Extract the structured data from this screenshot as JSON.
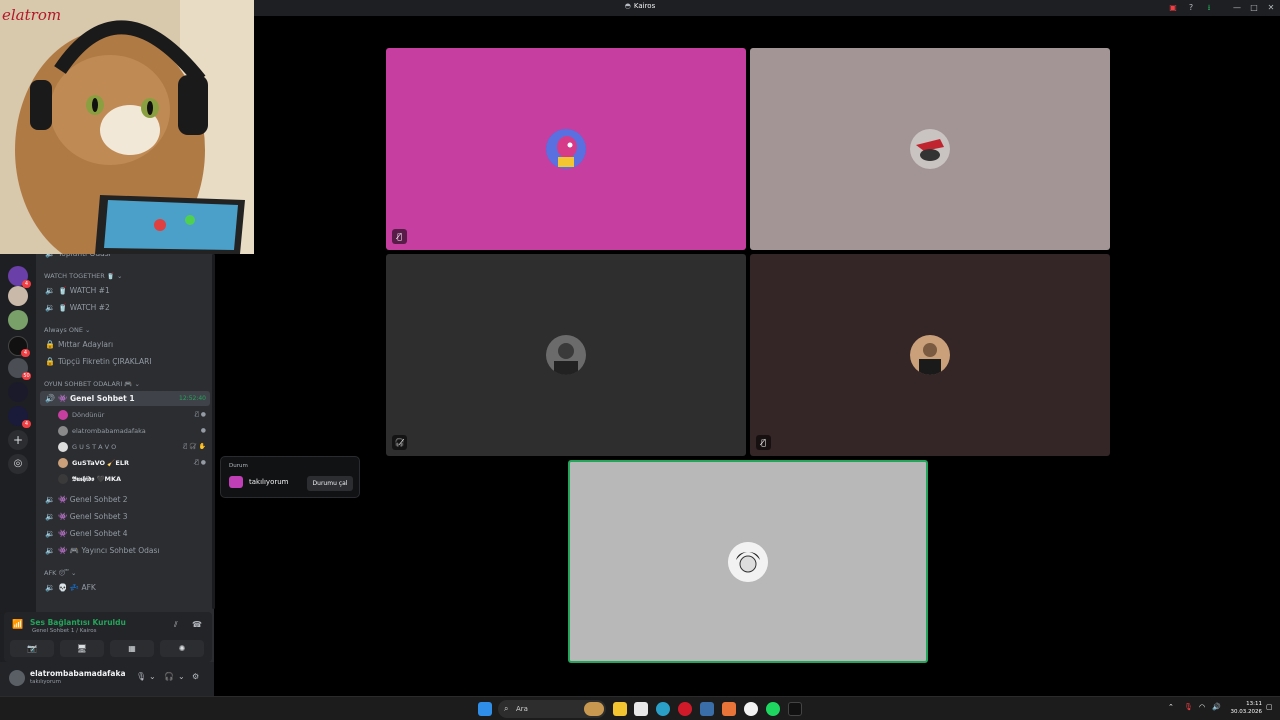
{
  "window": {
    "title": "Kairos"
  },
  "pip": {
    "label": "elatrom"
  },
  "channels": {
    "top_partial": "Toplantı Odası",
    "categories": [
      {
        "label": "WATCH TOGETHER 🥤 ⌄"
      },
      {
        "label": "Always ONE ⌄"
      },
      {
        "label": "OYUN SOHBET ODALARI 🎮 ⌄"
      },
      {
        "label": "AFK 😴 ⌄"
      }
    ],
    "items": [
      {
        "label": "🥤 WATCH #1"
      },
      {
        "label": "🥤 WATCH #2"
      },
      {
        "label": "Mıttar Adayları"
      },
      {
        "label": "Tüpçü Fikretin ÇIRAKLARI"
      },
      {
        "label": "👾 Genel Sohbet 1",
        "time": "12:52:40"
      },
      {
        "label": "👾 Genel Sohbet 2"
      },
      {
        "label": "👾 Genel Sohbet 3"
      },
      {
        "label": "👾 Genel Sohbet 4"
      },
      {
        "label": "👾 🎮 Yayıncı Sohbet Odası"
      },
      {
        "label": "💀 💤 AFK"
      }
    ],
    "voice_users": [
      {
        "name": "Döndünür"
      },
      {
        "name": "elatrombabamadafaka"
      },
      {
        "name": "G U S T A V O"
      },
      {
        "name": "GuSTaVO 🧹ELR"
      },
      {
        "name": "𝕭𝖚𝖘𝖍𝖎𝖉𝖔 🖤MKA"
      }
    ]
  },
  "voice_panel": {
    "status": "Ses Bağlantısı Kuruldu",
    "channel": "Genel Sohbet 1 / Kairos"
  },
  "user_panel": {
    "name": "elatrombabamadafaka",
    "status": "takılıyorum"
  },
  "status_popup": {
    "header": "Durum",
    "text": "takılıyorum",
    "button": "Durumu çal"
  },
  "taskbar": {
    "search_placeholder": "Ara",
    "time": "13:11",
    "date": "30.03.2026"
  },
  "colors": {
    "tile1": "#c63fa0",
    "tile2": "#a39595",
    "tile3": "#2e2e2f",
    "tile4": "#342527",
    "tile5": "#b8b8b8",
    "speaking": "#23a55a"
  }
}
